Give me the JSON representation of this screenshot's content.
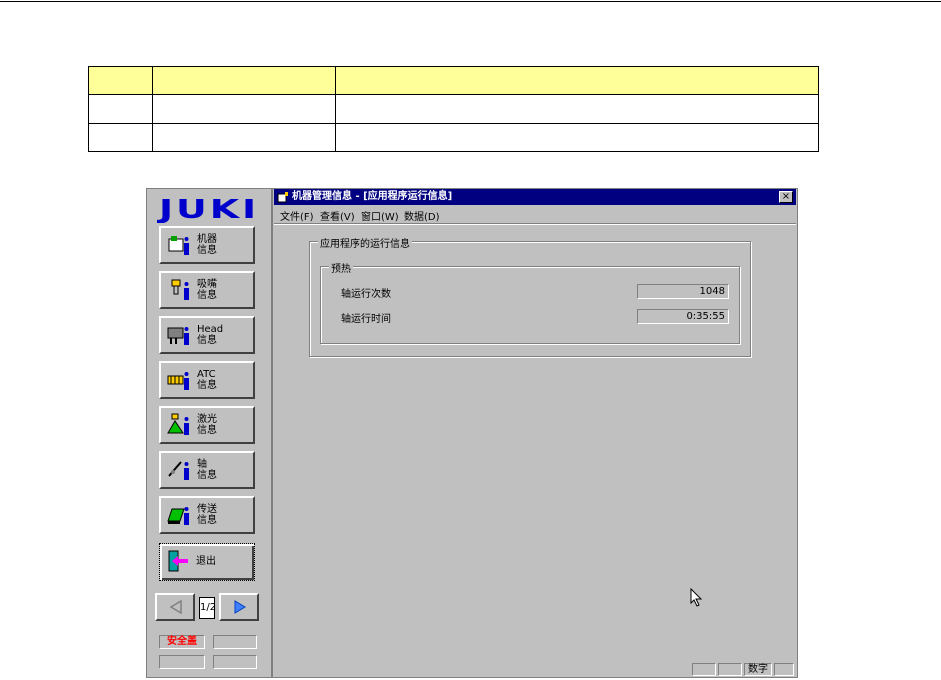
{
  "sidebar": {
    "logo": "JUKI",
    "buttons": [
      {
        "label": "机器\n信息",
        "icon": "machine-info-icon"
      },
      {
        "label": "吸嘴\n信息",
        "icon": "nozzle-info-icon"
      },
      {
        "label": "Head\n信息",
        "icon": "head-info-icon"
      },
      {
        "label": "ATC\n信息",
        "icon": "atc-info-icon"
      },
      {
        "label": "激光\n信息",
        "icon": "laser-info-icon"
      },
      {
        "label": "轴\n信息",
        "icon": "axis-info-icon"
      },
      {
        "label": "传送\n信息",
        "icon": "conveyor-info-icon"
      },
      {
        "label": "退出",
        "icon": "exit-door-icon"
      }
    ],
    "page_indicator": "1/2",
    "safety_status": "安全盖"
  },
  "window": {
    "title": "机器管理信息 - [应用程序运行信息]",
    "close": "×",
    "menu": [
      "文件(F)",
      "查看(V)",
      "窗口(W)",
      "数据(D)"
    ],
    "outer_group": "应用程序的运行信息",
    "inner_group": "预热",
    "fields": [
      {
        "label": "轴运行次数",
        "value": "1048"
      },
      {
        "label": "轴运行时间",
        "value": "0:35:55"
      }
    ],
    "status_bar": {
      "num_indicator": "数字"
    }
  },
  "colors": {
    "title_bar": "#000080",
    "face": "#c0c0c0",
    "table_header": "#ffff99",
    "safety_text": "#ff0000",
    "icon_accent": "#ffcc00"
  }
}
